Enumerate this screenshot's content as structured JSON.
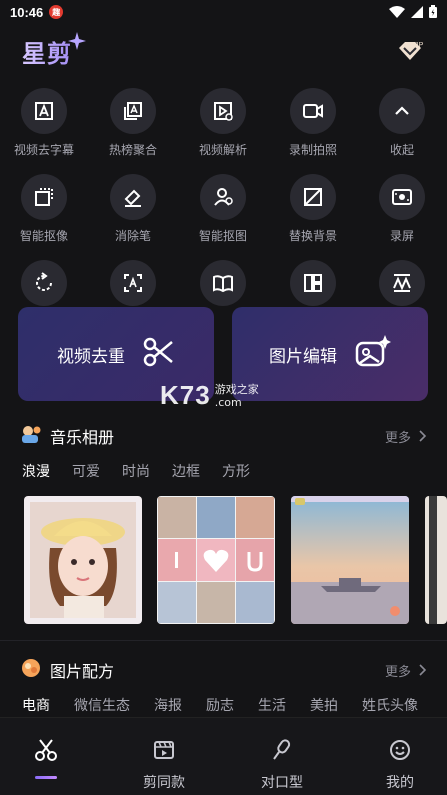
{
  "status_bar": {
    "time": "10:46",
    "notif_badge": "趣"
  },
  "header": {
    "logo": "星剪",
    "vip_label": "VIP"
  },
  "tools_row1": [
    {
      "label": "视频去字幕",
      "icon": "subtitle-remove-icon"
    },
    {
      "label": "热榜聚合",
      "icon": "trending-icon"
    },
    {
      "label": "视频解析",
      "icon": "video-parse-icon"
    },
    {
      "label": "录制拍照",
      "icon": "camera-record-icon"
    },
    {
      "label": "收起",
      "icon": "chevron-up-icon"
    }
  ],
  "tools_row2": [
    {
      "label": "智能抠像",
      "icon": "portrait-cutout-icon"
    },
    {
      "label": "消除笔",
      "icon": "eraser-icon"
    },
    {
      "label": "智能抠图",
      "icon": "image-cutout-icon"
    },
    {
      "label": "替换背景",
      "icon": "replace-bg-icon"
    },
    {
      "label": "录屏",
      "icon": "screen-record-icon"
    }
  ],
  "tools_row3": [
    {
      "label": "",
      "icon": "rotate-icon"
    },
    {
      "label": "",
      "icon": "text-recognize-icon"
    },
    {
      "label": "",
      "icon": "book-icon"
    },
    {
      "label": "",
      "icon": "layout-icon"
    },
    {
      "label": "",
      "icon": "watermark-icon"
    }
  ],
  "cards": {
    "left": "视频去重",
    "right": "图片编辑"
  },
  "watermark": {
    "brand": "K73",
    "sub": "游戏之家",
    "domain": ".com"
  },
  "music_album": {
    "title": "音乐相册",
    "more": "更多",
    "tabs": [
      "浪漫",
      "可爱",
      "时尚",
      "边框",
      "方形"
    ],
    "active_tab": 0
  },
  "image_recipe": {
    "title": "图片配方",
    "more": "更多",
    "tabs": [
      "电商",
      "微信生态",
      "海报",
      "励志",
      "生活",
      "美拍",
      "姓氏头像"
    ],
    "active_tab": 0
  },
  "bottom_nav": [
    {
      "label": "",
      "icon": "scissors-icon",
      "active": true
    },
    {
      "label": "剪同款",
      "icon": "clapboard-icon",
      "active": false
    },
    {
      "label": "对口型",
      "icon": "microphone-icon",
      "active": false
    },
    {
      "label": "我的",
      "icon": "smiley-icon",
      "active": false
    }
  ],
  "colors": {
    "background": "#141416",
    "tool_circle": "#2a2a31",
    "accent": "#a38df5"
  }
}
